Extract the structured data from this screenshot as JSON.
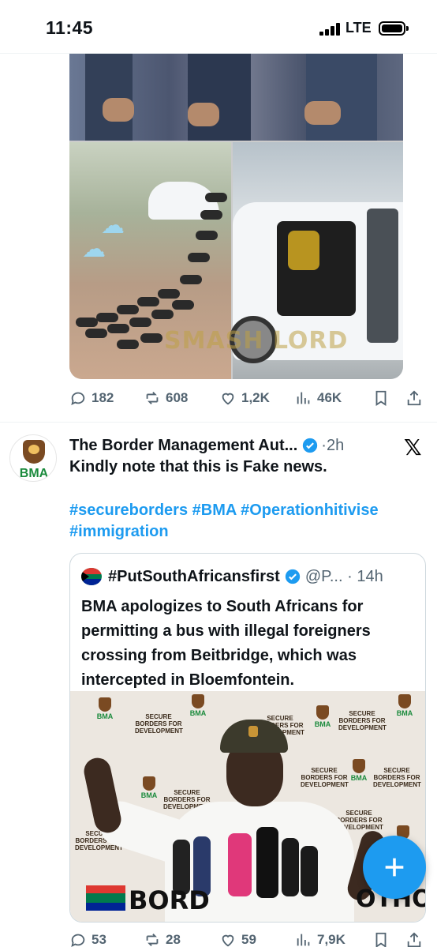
{
  "status_bar": {
    "time": "11:45",
    "network": "LTE"
  },
  "tweet1": {
    "media_watermark": "SMASH LORD",
    "actions": {
      "replies": "182",
      "reposts": "608",
      "likes": "1,2K",
      "views": "46K"
    }
  },
  "tweet2": {
    "author_name": "The Border Management Aut...",
    "time": "·2h",
    "avatar_text": "BMA",
    "text": "Kindly note that this is Fake news.",
    "hashtags": "#secureborders #BMA #Operationhitivise #immigration",
    "quote": {
      "author_name": "#PutSouthAfricansfirst",
      "handle": "@P... · 14h",
      "text": "BMA apologizes to South Africans for permitting a bus with illegal foreigners crossing from Beitbridge, which was intercepted in Bloemfontein.",
      "image": {
        "backdrop_text": "SECURE BORDERS FOR DEVELOPMENT",
        "backdrop_logo": "BMA",
        "banner_left": "BORD",
        "banner_right": "OTHOR"
      }
    },
    "actions": {
      "replies": "53",
      "reposts": "28",
      "likes": "59",
      "views": "7,9K"
    }
  },
  "icons": {
    "reply": "reply-icon",
    "repost": "repost-icon",
    "like": "heart-icon",
    "views": "views-icon",
    "bookmark": "bookmark-icon",
    "share": "share-icon",
    "compose": "plus-icon",
    "x": "x-logo-icon",
    "verified": "verified-badge-icon"
  },
  "colors": {
    "accent": "#1d9bf0",
    "text_secondary": "#536471",
    "verified": "#1d9bf0"
  }
}
